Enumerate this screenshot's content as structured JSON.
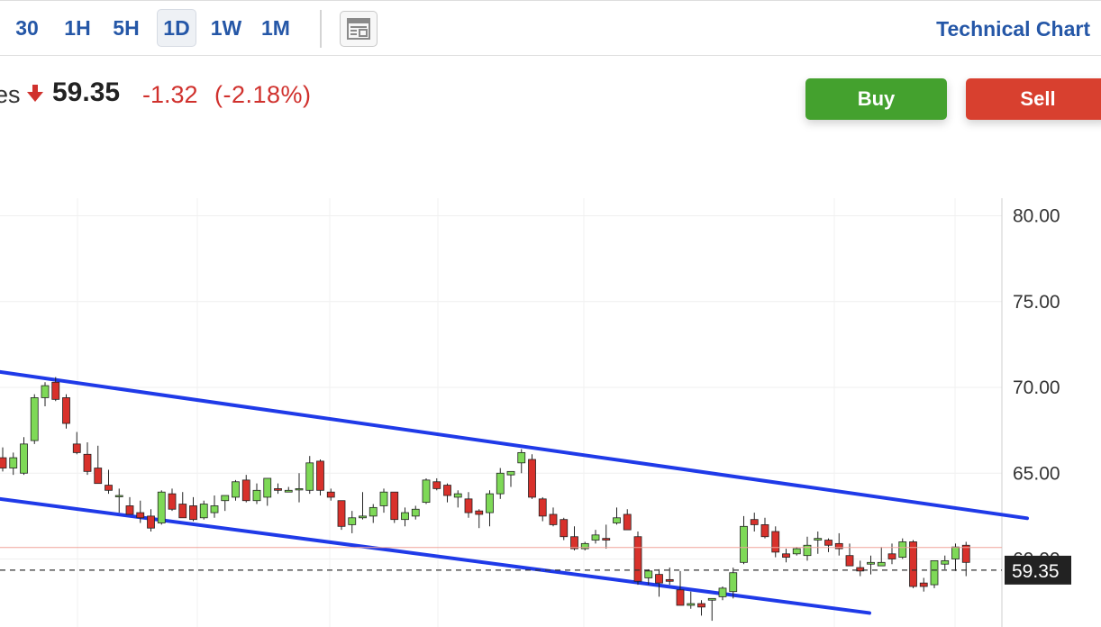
{
  "toolbar": {
    "timeframes": [
      "30",
      "1H",
      "5H",
      "1D",
      "1W",
      "1M"
    ],
    "active": "1D",
    "layout_icon": "layout-icon",
    "technical_chart": "Technical Chart"
  },
  "quote": {
    "name_fragment": "es",
    "direction_icon": "down-arrow-icon",
    "price": "59.35",
    "change": "-1.32",
    "change_pct": "(-2.18%)",
    "down_color": "#d0312d"
  },
  "actions": {
    "buy": "Buy",
    "sell": "Sell",
    "buy_color": "#44a12e",
    "sell_color": "#d8402f"
  },
  "chart_data": {
    "type": "candlestick",
    "y_ticks": [
      "80.00",
      "75.00",
      "70.00",
      "65.00",
      "60.00"
    ],
    "ylim": [
      56,
      81
    ],
    "last_price": 59.35,
    "last_price_label": "59.35",
    "prev_close": 60.67,
    "up_color": "#7ed957",
    "down_color": "#d8312b",
    "trendlines": [
      {
        "name": "upper",
        "from": [
          0,
          70.9
        ],
        "to": [
          101,
          62.0
        ]
      },
      {
        "name": "lower",
        "from": [
          0,
          63.5
        ],
        "to": [
          101,
          55.3
        ]
      }
    ],
    "candles": [
      [
        65.9,
        66.5,
        65.1,
        65.3
      ],
      [
        65.3,
        66.2,
        64.9,
        65.9
      ],
      [
        65.0,
        67.1,
        64.9,
        66.7
      ],
      [
        66.9,
        69.6,
        66.7,
        69.4
      ],
      [
        69.4,
        70.3,
        68.9,
        70.1
      ],
      [
        70.3,
        70.6,
        69.2,
        69.3
      ],
      [
        69.4,
        69.6,
        67.6,
        67.9
      ],
      [
        66.7,
        67.4,
        66.1,
        66.2
      ],
      [
        66.1,
        66.8,
        64.9,
        65.1
      ],
      [
        65.3,
        66.6,
        64.4,
        64.4
      ],
      [
        64.3,
        65.2,
        63.8,
        64.0
      ],
      [
        63.7,
        64.1,
        62.7,
        63.7
      ],
      [
        63.1,
        63.6,
        62.6,
        62.6
      ],
      [
        62.7,
        63.4,
        62.1,
        62.4
      ],
      [
        62.5,
        62.9,
        61.6,
        61.8
      ],
      [
        62.1,
        64.0,
        62.0,
        63.9
      ],
      [
        63.8,
        64.1,
        62.8,
        62.9
      ],
      [
        63.2,
        63.9,
        62.4,
        62.4
      ],
      [
        63.1,
        63.6,
        62.2,
        62.3
      ],
      [
        62.4,
        63.4,
        62.3,
        63.2
      ],
      [
        62.7,
        63.7,
        62.4,
        63.1
      ],
      [
        63.4,
        63.7,
        62.8,
        63.7
      ],
      [
        63.6,
        64.6,
        63.4,
        64.5
      ],
      [
        64.6,
        64.9,
        63.3,
        63.4
      ],
      [
        63.4,
        64.4,
        63.2,
        64.0
      ],
      [
        63.6,
        64.7,
        63.1,
        64.7
      ],
      [
        64.1,
        64.4,
        63.8,
        64.0
      ],
      [
        63.9,
        64.2,
        63.9,
        64.0
      ],
      [
        64.1,
        65.0,
        63.3,
        64.1
      ],
      [
        64.0,
        66.0,
        63.8,
        65.6
      ],
      [
        65.7,
        65.8,
        63.7,
        64.0
      ],
      [
        63.9,
        64.1,
        63.4,
        63.6
      ],
      [
        63.4,
        63.4,
        61.7,
        61.9
      ],
      [
        62.0,
        62.8,
        61.5,
        62.4
      ],
      [
        62.4,
        63.9,
        62.3,
        62.5
      ],
      [
        62.5,
        63.2,
        62.1,
        63.0
      ],
      [
        63.1,
        64.1,
        62.7,
        63.9
      ],
      [
        63.9,
        63.9,
        62.1,
        62.3
      ],
      [
        62.3,
        63.0,
        61.9,
        62.7
      ],
      [
        62.5,
        63.1,
        62.3,
        62.9
      ],
      [
        63.3,
        64.7,
        63.2,
        64.6
      ],
      [
        64.5,
        64.7,
        64.0,
        64.1
      ],
      [
        64.3,
        64.4,
        63.3,
        63.7
      ],
      [
        63.6,
        64.0,
        63.0,
        63.8
      ],
      [
        63.5,
        63.9,
        62.4,
        62.7
      ],
      [
        62.8,
        62.9,
        61.8,
        62.6
      ],
      [
        62.7,
        64.0,
        61.9,
        63.8
      ],
      [
        63.8,
        65.3,
        63.5,
        65.0
      ],
      [
        64.9,
        65.0,
        64.2,
        65.1
      ],
      [
        65.6,
        66.4,
        65.0,
        66.2
      ],
      [
        65.8,
        66.1,
        63.5,
        63.6
      ],
      [
        63.5,
        63.6,
        62.2,
        62.5
      ],
      [
        62.6,
        63.0,
        61.9,
        62.0
      ],
      [
        62.3,
        62.4,
        61.1,
        61.3
      ],
      [
        61.3,
        61.9,
        60.5,
        60.6
      ],
      [
        60.6,
        61.0,
        60.5,
        60.9
      ],
      [
        61.1,
        61.7,
        60.9,
        61.4
      ],
      [
        61.2,
        62.0,
        60.6,
        61.1
      ],
      [
        62.1,
        63.0,
        62.0,
        62.4
      ],
      [
        62.6,
        62.9,
        61.9,
        61.7
      ],
      [
        61.3,
        61.6,
        58.5,
        58.7
      ],
      [
        58.9,
        59.4,
        58.5,
        59.3
      ],
      [
        59.1,
        59.4,
        57.8,
        58.6
      ],
      [
        58.8,
        59.5,
        58.5,
        58.7
      ],
      [
        58.2,
        59.3,
        58.1,
        57.3
      ],
      [
        57.3,
        58.1,
        57.1,
        57.4
      ],
      [
        57.4,
        57.6,
        56.7,
        57.2
      ],
      [
        57.6,
        57.7,
        56.4,
        57.7
      ],
      [
        57.8,
        58.4,
        57.6,
        58.3
      ],
      [
        58.1,
        59.5,
        57.7,
        59.2
      ],
      [
        59.8,
        62.5,
        59.7,
        61.9
      ],
      [
        62.3,
        62.7,
        61.6,
        62.0
      ],
      [
        62.0,
        62.4,
        61.2,
        61.3
      ],
      [
        61.6,
        61.9,
        60.1,
        60.4
      ],
      [
        60.3,
        60.6,
        59.8,
        60.1
      ],
      [
        60.3,
        60.7,
        60.2,
        60.6
      ],
      [
        60.2,
        61.3,
        59.9,
        60.8
      ],
      [
        61.1,
        61.6,
        60.3,
        61.2
      ],
      [
        61.1,
        61.2,
        60.4,
        60.8
      ],
      [
        60.9,
        61.5,
        60.2,
        60.6
      ],
      [
        60.2,
        60.9,
        59.9,
        59.6
      ],
      [
        59.5,
        59.9,
        59.0,
        59.3
      ],
      [
        59.7,
        60.2,
        59.1,
        59.8
      ],
      [
        59.6,
        60.7,
        59.6,
        59.8
      ],
      [
        60.3,
        60.9,
        59.7,
        60.0
      ],
      [
        60.1,
        61.2,
        60.0,
        61.0
      ],
      [
        61.0,
        61.1,
        58.3,
        58.4
      ],
      [
        58.6,
        58.9,
        58.1,
        58.4
      ],
      [
        58.5,
        59.3,
        58.3,
        59.9
      ],
      [
        59.7,
        60.2,
        59.4,
        59.9
      ],
      [
        60.0,
        60.9,
        59.3,
        60.7
      ],
      [
        60.8,
        61.0,
        59.0,
        59.8
      ]
    ]
  }
}
